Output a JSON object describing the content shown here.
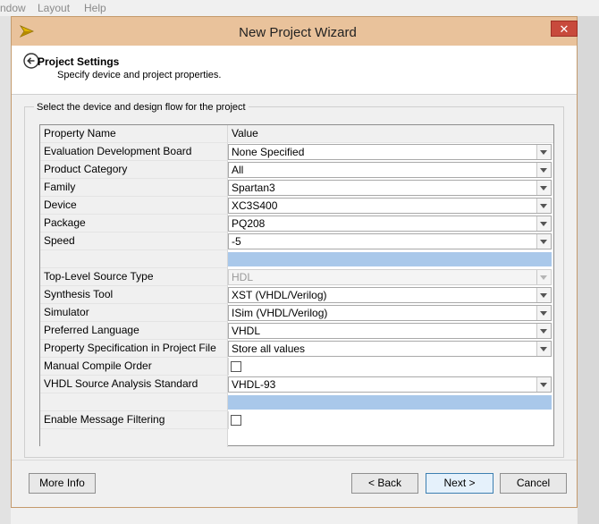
{
  "menu": [
    "ndow",
    "Layout",
    "Help"
  ],
  "window": {
    "title": "New Project Wizard",
    "close_label": "✕"
  },
  "header": {
    "title": "Project Settings",
    "subtitle": "Specify device and project properties."
  },
  "group": {
    "legend": "Select the device and design flow for the project"
  },
  "grid": {
    "col_name": "Property Name",
    "col_value": "Value",
    "rows": [
      {
        "name": "Evaluation Development Board",
        "value": "None Specified"
      },
      {
        "name": "Product Category",
        "value": "All"
      },
      {
        "name": "Family",
        "value": "Spartan3"
      },
      {
        "name": "Device",
        "value": "XC3S400"
      },
      {
        "name": "Package",
        "value": "PQ208"
      },
      {
        "name": "Speed",
        "value": "-5"
      },
      {
        "name": "Top-Level Source Type",
        "value": "HDL"
      },
      {
        "name": "Synthesis Tool",
        "value": "XST (VHDL/Verilog)"
      },
      {
        "name": "Simulator",
        "value": "ISim (VHDL/Verilog)"
      },
      {
        "name": "Preferred Language",
        "value": "VHDL"
      },
      {
        "name": "Property Specification in Project File",
        "value": "Store all values"
      },
      {
        "name": "Manual Compile Order",
        "value": ""
      },
      {
        "name": "VHDL Source Analysis Standard",
        "value": "VHDL-93"
      },
      {
        "name": "Enable Message Filtering",
        "value": ""
      }
    ]
  },
  "buttons": {
    "more_info": "More Info",
    "back": "< Back",
    "next": "Next >",
    "cancel": "Cancel"
  },
  "colors": {
    "titlebar": "#e9c29b",
    "close": "#c84a3c",
    "selection": "#a9c8ea"
  }
}
